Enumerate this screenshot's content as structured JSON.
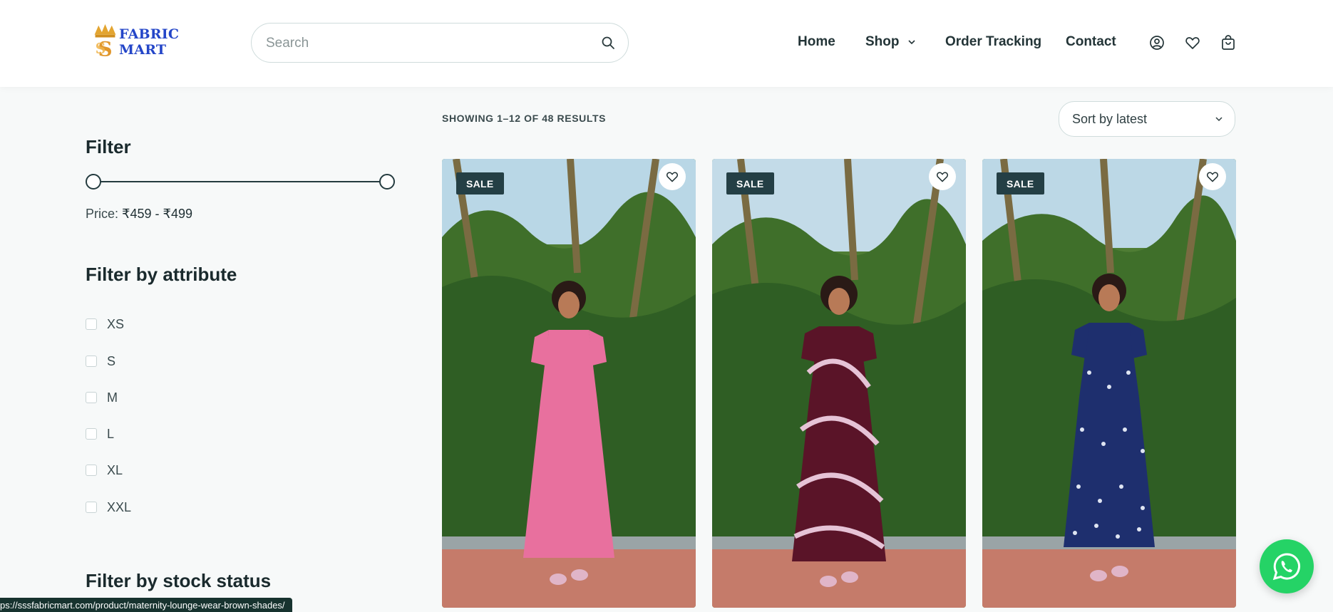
{
  "brand": {
    "name": "FABRIC MART",
    "brand_color": "#2446c8",
    "accent": "#243f45"
  },
  "search": {
    "placeholder": "Search"
  },
  "nav": {
    "home": "Home",
    "shop": "Shop",
    "order_tracking": "Order Tracking",
    "contact": "Contact"
  },
  "header_icons": [
    "account-icon",
    "wishlist-heart-icon",
    "cart-icon"
  ],
  "sidebar": {
    "filter_title": "Filter",
    "price_label": "Price:",
    "price_range": "₹459 - ₹499",
    "attribute_title": "Filter by attribute",
    "sizes": [
      "XS",
      "S",
      "M",
      "L",
      "XL",
      "XXL"
    ],
    "stock_title": "Filter by stock status"
  },
  "results_text": "SHOWING 1–12 OF 48 RESULTS",
  "sort": {
    "selected": "Sort by latest"
  },
  "products": [
    {
      "badge": "SALE",
      "dress_color": "#e8709e"
    },
    {
      "badge": "SALE",
      "dress_color": "#5a1428"
    },
    {
      "badge": "SALE",
      "dress_color": "#1e2f6e"
    }
  ],
  "status_url": "ps://sssfabricmart.com/product/maternity-lounge-wear-brown-shades/"
}
